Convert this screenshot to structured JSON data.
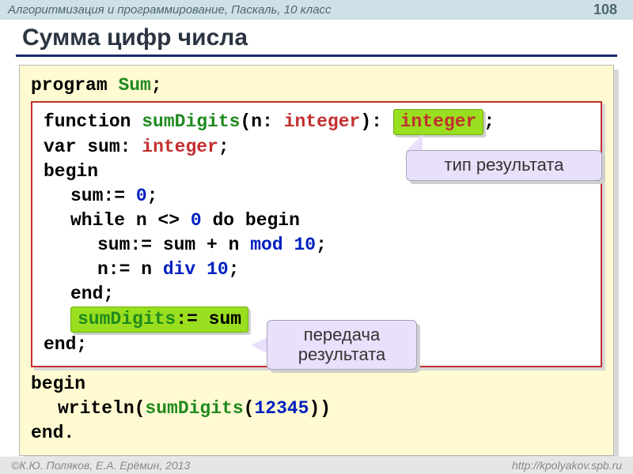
{
  "header": {
    "course": "Алгоритмизация и программирование, Паскаль, 10 класс",
    "page": "108"
  },
  "title": "Сумма цифр числа",
  "code": {
    "program_kw": "program",
    "program_name": "Sum",
    "semi": ";",
    "function_kw": "function",
    "func_name": "sumDigits",
    "sig_open": "(n:",
    "integer": "integer",
    "sig_close": "):",
    "return_type": "integer",
    "var_line_kw": "var",
    "var_line_rest": "sum:",
    "begin": "begin",
    "assign_zero_l": "sum:=",
    "zero": "0",
    "while_kw": "while",
    "while_mid": "n <>",
    "while_zero": "0",
    "do_begin": "do begin",
    "sum_expr_l": "sum:= sum + n",
    "mod": "mod",
    "ten_a": "10",
    "n_expr_l": "n:= n",
    "div": "div",
    "ten_b": "10",
    "end_kw": "end",
    "result_assign_name": "sumDigits",
    "result_assign_rest": ":= sum",
    "writeln_l": "writeln(",
    "call_name": "sumDigits",
    "arg_open": "(",
    "arg_val": "12345",
    "arg_close": "))",
    "end_dot": "end."
  },
  "callouts": {
    "return_type": "тип результата",
    "pass_result": "передача результата"
  },
  "footer": {
    "left": "©К.Ю. Поляков, Е.А. Ерёмин, 2013",
    "right": "http://kpolyakov.spb.ru"
  }
}
